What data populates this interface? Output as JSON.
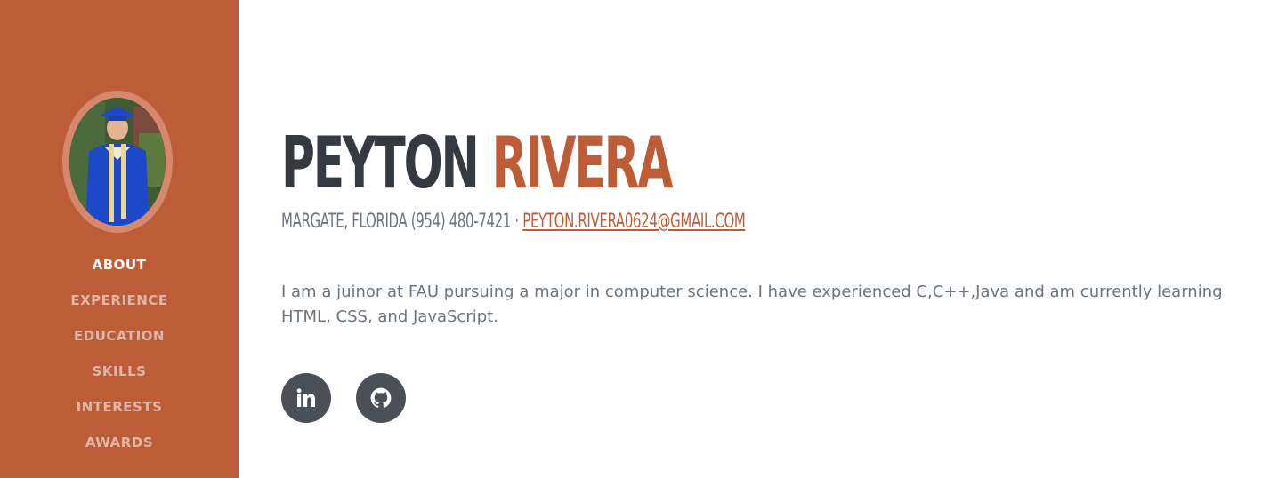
{
  "profile": {
    "first_name": "PEYTON",
    "last_name": "RIVERA",
    "location_phone": "MARGATE, FLORIDA (954) 480-7421 · ",
    "email": "PEYTON.RIVERA0624@GMAIL.COM",
    "bio": "I am a juinor at FAU pursuing a major in computer science. I have experienced C,C++,Java and am currently learning HTML, CSS, and JavaScript."
  },
  "nav": {
    "items": [
      {
        "label": "ABOUT",
        "active": true
      },
      {
        "label": "EXPERIENCE"
      },
      {
        "label": "EDUCATION"
      },
      {
        "label": "SKILLS"
      },
      {
        "label": "INTERESTS"
      },
      {
        "label": "AWARDS"
      }
    ]
  },
  "social": [
    {
      "icon": "linkedin-icon"
    },
    {
      "icon": "github-icon"
    }
  ],
  "colors": {
    "brand": "#bd5d38",
    "dark": "#343a40",
    "muted": "#6c757d",
    "social_bg": "#495057"
  }
}
